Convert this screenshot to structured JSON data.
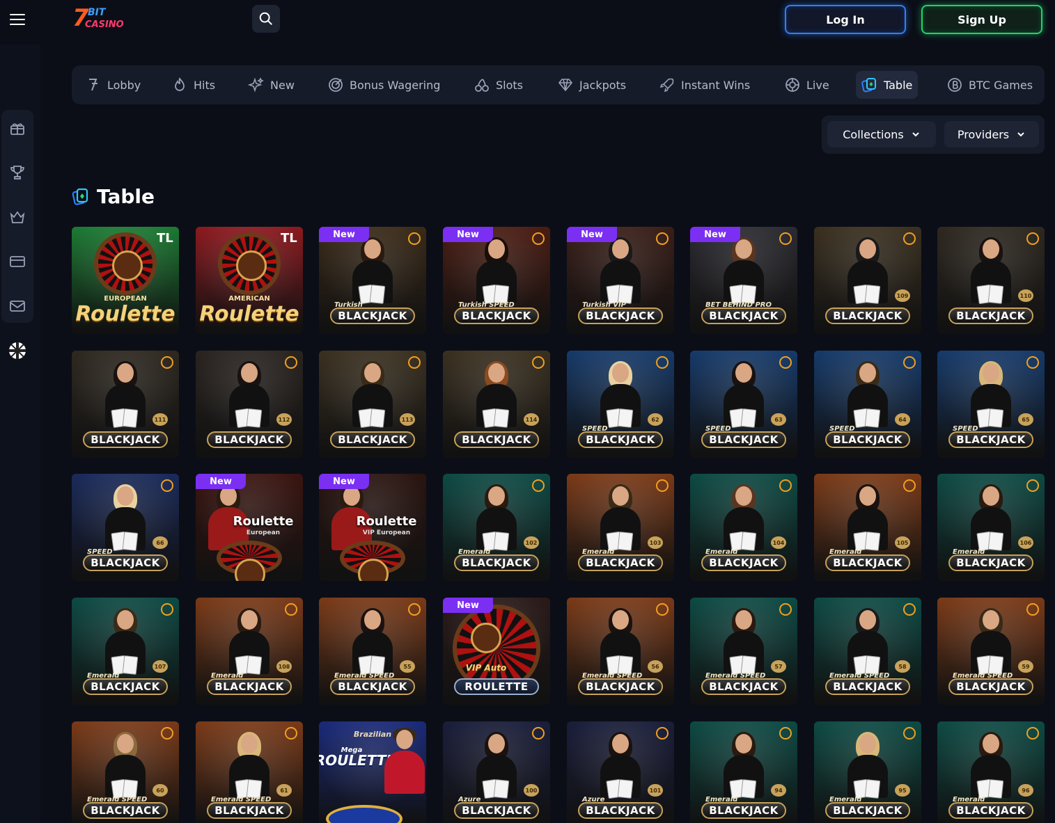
{
  "brand": {
    "logo_number": "7",
    "logo_word": "BIT",
    "logo_sub": "CASINO"
  },
  "header": {
    "login_label": "Log In",
    "signup_label": "Sign Up"
  },
  "nav": {
    "tabs": [
      {
        "label": "Lobby",
        "icon": "lobby-icon"
      },
      {
        "label": "Hits",
        "icon": "fire-icon"
      },
      {
        "label": "New",
        "icon": "sparkles-icon"
      },
      {
        "label": "Bonus Wagering",
        "icon": "target-icon"
      },
      {
        "label": "Slots",
        "icon": "cherries-icon"
      },
      {
        "label": "Jackpots",
        "icon": "diamond-icon"
      },
      {
        "label": "Instant Wins",
        "icon": "rocket-icon"
      },
      {
        "label": "Live",
        "icon": "chip-icon"
      },
      {
        "label": "Table",
        "icon": "table-cards-icon",
        "active": true
      },
      {
        "label": "BTC Games",
        "icon": "bitcoin-icon"
      }
    ]
  },
  "filters": {
    "collections_label": "Collections",
    "providers_label": "Providers"
  },
  "section": {
    "title": "Table"
  },
  "sidebar_icons": [
    "gift-icon",
    "trophy-icon",
    "crown-icon",
    "card-icon",
    "mail-icon",
    "uk-flag-icon"
  ],
  "badges": {
    "new": "New"
  },
  "games": [
    {
      "type": "roulette-logo",
      "title": "Roulette",
      "sub": "EUROPEAN",
      "bg": "#1c7a33",
      "provider": "TL"
    },
    {
      "type": "roulette-logo",
      "title": "Roulette",
      "sub": "AMERICAN",
      "bg": "#8b1a1f",
      "provider": "TL"
    },
    {
      "type": "blackjack",
      "plaque": "BLACKJACK",
      "sub": "Turkish",
      "bg": "#3a2a18",
      "new": true,
      "hair": "#2a1a10"
    },
    {
      "type": "blackjack",
      "plaque": "BLACKJACK",
      "sub": "Turkish SPEED",
      "bg": "#4a1c12",
      "new": true,
      "hair": "#1a0e08"
    },
    {
      "type": "blackjack",
      "plaque": "BLACKJACK",
      "sub": "Turkish VIP",
      "bg": "#3a1e18",
      "new": true,
      "hair": "#1a1a1a"
    },
    {
      "type": "blackjack",
      "plaque": "BLACKJACK",
      "sub": "BET BEHIND PRO",
      "bg": "#2a2a30",
      "new": true,
      "hair": "#5a3520"
    },
    {
      "type": "blackjack",
      "plaque": "BLACKJACK",
      "num": "109",
      "bg": "#3a3020",
      "hair": "#1a1a1a"
    },
    {
      "type": "blackjack",
      "plaque": "BLACKJACK",
      "num": "110",
      "bg": "#2e2820",
      "hair": "#1a1210"
    },
    {
      "type": "blackjack",
      "plaque": "BLACKJACK",
      "num": "111",
      "bg": "#2e2820",
      "hair": "#1a1210"
    },
    {
      "type": "blackjack",
      "plaque": "BLACKJACK",
      "num": "112",
      "bg": "#2a2420",
      "hair": "#1a1210"
    },
    {
      "type": "blackjack",
      "plaque": "BLACKJACK",
      "num": "113",
      "bg": "#3a3020",
      "hair": "#3a2a18"
    },
    {
      "type": "blackjack",
      "plaque": "BLACKJACK",
      "num": "114",
      "bg": "#3a3020",
      "hair": "#8a4a20"
    },
    {
      "type": "blackjack",
      "plaque": "BLACKJACK",
      "sub": "SPEED",
      "num": "62",
      "bg": "#163a6a",
      "hair": "#e8d2a0"
    },
    {
      "type": "blackjack",
      "plaque": "BLACKJACK",
      "sub": "SPEED",
      "num": "63",
      "bg": "#163a6a",
      "hair": "#1a1210"
    },
    {
      "type": "blackjack",
      "plaque": "BLACKJACK",
      "sub": "SPEED",
      "num": "64",
      "bg": "#163a6a",
      "hair": "#3a2a18"
    },
    {
      "type": "blackjack",
      "plaque": "BLACKJACK",
      "sub": "SPEED",
      "num": "65",
      "bg": "#163a6a",
      "hair": "#d8b878"
    },
    {
      "type": "blackjack",
      "plaque": "BLACKJACK",
      "sub": "SPEED",
      "num": "66",
      "bg": "#1a2a5a",
      "hair": "#e8d2a0"
    },
    {
      "type": "roulette-live",
      "title": "Roulette",
      "sub": "European",
      "bg": "#3a1410",
      "new": true
    },
    {
      "type": "roulette-live",
      "title": "Roulette",
      "sub": "VIP European",
      "bg": "#2a1410",
      "new": true
    },
    {
      "type": "blackjack",
      "plaque": "BLACKJACK",
      "sub": "Emerald",
      "num": "102",
      "bg": "#0e4a44",
      "hair": "#2a1a10"
    },
    {
      "type": "blackjack",
      "plaque": "BLACKJACK",
      "sub": "Emerald",
      "num": "103",
      "bg": "#7a3a18",
      "hair": "#3a2a18"
    },
    {
      "type": "blackjack",
      "plaque": "BLACKJACK",
      "sub": "Emerald",
      "num": "104",
      "bg": "#0e4a44",
      "hair": "#5a3520"
    },
    {
      "type": "blackjack",
      "plaque": "BLACKJACK",
      "sub": "Emerald",
      "num": "105",
      "bg": "#7a3a18",
      "hair": "#1a1210"
    },
    {
      "type": "blackjack",
      "plaque": "BLACKJACK",
      "sub": "Emerald",
      "num": "106",
      "bg": "#0e4a44",
      "hair": "#2a1a10"
    },
    {
      "type": "blackjack",
      "plaque": "BLACKJACK",
      "sub": "Emerald",
      "num": "107",
      "bg": "#0e4a44",
      "hair": "#3a2a18"
    },
    {
      "type": "blackjack",
      "plaque": "BLACKJACK",
      "sub": "Emerald",
      "num": "108",
      "bg": "#7a3a18",
      "hair": "#2a1a10"
    },
    {
      "type": "blackjack",
      "plaque": "BLACKJACK",
      "sub": "Emerald SPEED",
      "num": "55",
      "bg": "#7a3a18",
      "hair": "#1a1210"
    },
    {
      "type": "roulette-vip",
      "title": "ROULETTE",
      "sub": "VIP Auto",
      "bg": "#2a1a18",
      "new": true
    },
    {
      "type": "blackjack",
      "plaque": "BLACKJACK",
      "sub": "Emerald SPEED",
      "num": "56",
      "bg": "#7a3a18",
      "hair": "#1a1210"
    },
    {
      "type": "blackjack",
      "plaque": "BLACKJACK",
      "sub": "Emerald SPEED",
      "num": "57",
      "bg": "#0e4a44",
      "hair": "#2a1a10"
    },
    {
      "type": "blackjack",
      "plaque": "BLACKJACK",
      "sub": "Emerald SPEED",
      "num": "58",
      "bg": "#0e4a44",
      "hair": "#1a1a1a"
    },
    {
      "type": "blackjack",
      "plaque": "BLACKJACK",
      "sub": "Emerald SPEED",
      "num": "59",
      "bg": "#7a3a18",
      "hair": "#3a2a18"
    },
    {
      "type": "blackjack",
      "plaque": "BLACKJACK",
      "sub": "Emerald SPEED",
      "num": "60",
      "bg": "#7a3a18",
      "hair": "#8a6a40"
    },
    {
      "type": "blackjack",
      "plaque": "BLACKJACK",
      "sub": "Emerald SPEED",
      "num": "61",
      "bg": "#7a3a18",
      "hair": "#d8b878"
    },
    {
      "type": "roulette-mega",
      "title": "ROULETTE",
      "sub": "Brazilian",
      "sub2": "Mega",
      "bg": "#1a2a7a"
    },
    {
      "type": "blackjack",
      "plaque": "BLACKJACK",
      "sub": "Azure",
      "num": "100",
      "bg": "#1a1e3a",
      "hair": "#1a1210"
    },
    {
      "type": "blackjack",
      "plaque": "BLACKJACK",
      "sub": "Azure",
      "num": "101",
      "bg": "#1a1e3a",
      "hair": "#1a1210"
    },
    {
      "type": "blackjack",
      "plaque": "BLACKJACK",
      "sub": "Emerald",
      "num": "94",
      "bg": "#0e4a44",
      "hair": "#2a1a10"
    },
    {
      "type": "blackjack",
      "plaque": "BLACKJACK",
      "sub": "Emerald",
      "num": "95",
      "bg": "#0e4a44",
      "hair": "#d8b878"
    },
    {
      "type": "blackjack",
      "plaque": "BLACKJACK",
      "sub": "Emerald",
      "num": "96",
      "bg": "#0e4a44",
      "hair": "#2a1a10"
    }
  ]
}
